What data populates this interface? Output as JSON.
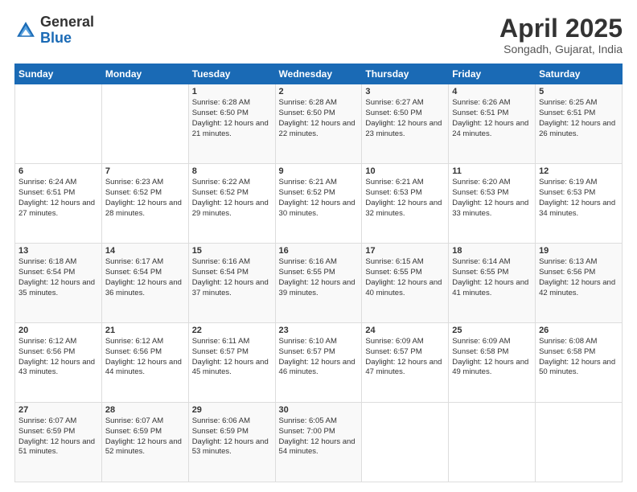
{
  "header": {
    "logo_general": "General",
    "logo_blue": "Blue",
    "title": "April 2025",
    "subtitle": "Songadh, Gujarat, India"
  },
  "calendar": {
    "days_of_week": [
      "Sunday",
      "Monday",
      "Tuesday",
      "Wednesday",
      "Thursday",
      "Friday",
      "Saturday"
    ],
    "weeks": [
      [
        {
          "day": "",
          "sunrise": "",
          "sunset": "",
          "daylight": ""
        },
        {
          "day": "",
          "sunrise": "",
          "sunset": "",
          "daylight": ""
        },
        {
          "day": "1",
          "sunrise": "Sunrise: 6:28 AM",
          "sunset": "Sunset: 6:50 PM",
          "daylight": "Daylight: 12 hours and 21 minutes."
        },
        {
          "day": "2",
          "sunrise": "Sunrise: 6:28 AM",
          "sunset": "Sunset: 6:50 PM",
          "daylight": "Daylight: 12 hours and 22 minutes."
        },
        {
          "day": "3",
          "sunrise": "Sunrise: 6:27 AM",
          "sunset": "Sunset: 6:50 PM",
          "daylight": "Daylight: 12 hours and 23 minutes."
        },
        {
          "day": "4",
          "sunrise": "Sunrise: 6:26 AM",
          "sunset": "Sunset: 6:51 PM",
          "daylight": "Daylight: 12 hours and 24 minutes."
        },
        {
          "day": "5",
          "sunrise": "Sunrise: 6:25 AM",
          "sunset": "Sunset: 6:51 PM",
          "daylight": "Daylight: 12 hours and 26 minutes."
        }
      ],
      [
        {
          "day": "6",
          "sunrise": "Sunrise: 6:24 AM",
          "sunset": "Sunset: 6:51 PM",
          "daylight": "Daylight: 12 hours and 27 minutes."
        },
        {
          "day": "7",
          "sunrise": "Sunrise: 6:23 AM",
          "sunset": "Sunset: 6:52 PM",
          "daylight": "Daylight: 12 hours and 28 minutes."
        },
        {
          "day": "8",
          "sunrise": "Sunrise: 6:22 AM",
          "sunset": "Sunset: 6:52 PM",
          "daylight": "Daylight: 12 hours and 29 minutes."
        },
        {
          "day": "9",
          "sunrise": "Sunrise: 6:21 AM",
          "sunset": "Sunset: 6:52 PM",
          "daylight": "Daylight: 12 hours and 30 minutes."
        },
        {
          "day": "10",
          "sunrise": "Sunrise: 6:21 AM",
          "sunset": "Sunset: 6:53 PM",
          "daylight": "Daylight: 12 hours and 32 minutes."
        },
        {
          "day": "11",
          "sunrise": "Sunrise: 6:20 AM",
          "sunset": "Sunset: 6:53 PM",
          "daylight": "Daylight: 12 hours and 33 minutes."
        },
        {
          "day": "12",
          "sunrise": "Sunrise: 6:19 AM",
          "sunset": "Sunset: 6:53 PM",
          "daylight": "Daylight: 12 hours and 34 minutes."
        }
      ],
      [
        {
          "day": "13",
          "sunrise": "Sunrise: 6:18 AM",
          "sunset": "Sunset: 6:54 PM",
          "daylight": "Daylight: 12 hours and 35 minutes."
        },
        {
          "day": "14",
          "sunrise": "Sunrise: 6:17 AM",
          "sunset": "Sunset: 6:54 PM",
          "daylight": "Daylight: 12 hours and 36 minutes."
        },
        {
          "day": "15",
          "sunrise": "Sunrise: 6:16 AM",
          "sunset": "Sunset: 6:54 PM",
          "daylight": "Daylight: 12 hours and 37 minutes."
        },
        {
          "day": "16",
          "sunrise": "Sunrise: 6:16 AM",
          "sunset": "Sunset: 6:55 PM",
          "daylight": "Daylight: 12 hours and 39 minutes."
        },
        {
          "day": "17",
          "sunrise": "Sunrise: 6:15 AM",
          "sunset": "Sunset: 6:55 PM",
          "daylight": "Daylight: 12 hours and 40 minutes."
        },
        {
          "day": "18",
          "sunrise": "Sunrise: 6:14 AM",
          "sunset": "Sunset: 6:55 PM",
          "daylight": "Daylight: 12 hours and 41 minutes."
        },
        {
          "day": "19",
          "sunrise": "Sunrise: 6:13 AM",
          "sunset": "Sunset: 6:56 PM",
          "daylight": "Daylight: 12 hours and 42 minutes."
        }
      ],
      [
        {
          "day": "20",
          "sunrise": "Sunrise: 6:12 AM",
          "sunset": "Sunset: 6:56 PM",
          "daylight": "Daylight: 12 hours and 43 minutes."
        },
        {
          "day": "21",
          "sunrise": "Sunrise: 6:12 AM",
          "sunset": "Sunset: 6:56 PM",
          "daylight": "Daylight: 12 hours and 44 minutes."
        },
        {
          "day": "22",
          "sunrise": "Sunrise: 6:11 AM",
          "sunset": "Sunset: 6:57 PM",
          "daylight": "Daylight: 12 hours and 45 minutes."
        },
        {
          "day": "23",
          "sunrise": "Sunrise: 6:10 AM",
          "sunset": "Sunset: 6:57 PM",
          "daylight": "Daylight: 12 hours and 46 minutes."
        },
        {
          "day": "24",
          "sunrise": "Sunrise: 6:09 AM",
          "sunset": "Sunset: 6:57 PM",
          "daylight": "Daylight: 12 hours and 47 minutes."
        },
        {
          "day": "25",
          "sunrise": "Sunrise: 6:09 AM",
          "sunset": "Sunset: 6:58 PM",
          "daylight": "Daylight: 12 hours and 49 minutes."
        },
        {
          "day": "26",
          "sunrise": "Sunrise: 6:08 AM",
          "sunset": "Sunset: 6:58 PM",
          "daylight": "Daylight: 12 hours and 50 minutes."
        }
      ],
      [
        {
          "day": "27",
          "sunrise": "Sunrise: 6:07 AM",
          "sunset": "Sunset: 6:59 PM",
          "daylight": "Daylight: 12 hours and 51 minutes."
        },
        {
          "day": "28",
          "sunrise": "Sunrise: 6:07 AM",
          "sunset": "Sunset: 6:59 PM",
          "daylight": "Daylight: 12 hours and 52 minutes."
        },
        {
          "day": "29",
          "sunrise": "Sunrise: 6:06 AM",
          "sunset": "Sunset: 6:59 PM",
          "daylight": "Daylight: 12 hours and 53 minutes."
        },
        {
          "day": "30",
          "sunrise": "Sunrise: 6:05 AM",
          "sunset": "Sunset: 7:00 PM",
          "daylight": "Daylight: 12 hours and 54 minutes."
        },
        {
          "day": "",
          "sunrise": "",
          "sunset": "",
          "daylight": ""
        },
        {
          "day": "",
          "sunrise": "",
          "sunset": "",
          "daylight": ""
        },
        {
          "day": "",
          "sunrise": "",
          "sunset": "",
          "daylight": ""
        }
      ]
    ]
  }
}
